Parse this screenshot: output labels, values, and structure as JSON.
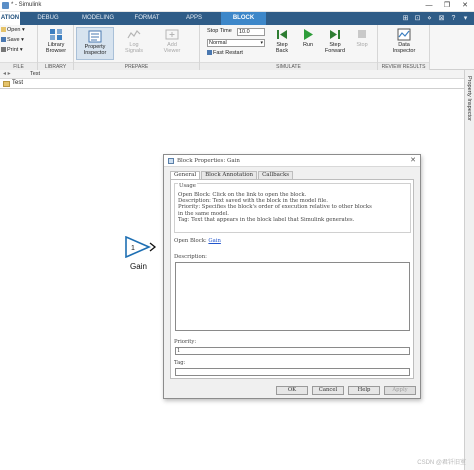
{
  "window": {
    "title": "* - Simulink",
    "controls": [
      "—",
      "❐",
      "✕"
    ]
  },
  "ribbon": {
    "tabs": [
      {
        "label": "ATION",
        "state": "active"
      },
      {
        "label": "DEBUG",
        "state": "normal"
      },
      {
        "label": "MODELING",
        "state": "normal"
      },
      {
        "label": "FORMAT",
        "state": "normal"
      },
      {
        "label": "APPS",
        "state": "normal"
      },
      {
        "label": "BLOCK",
        "state": "block"
      }
    ],
    "right_icons": [
      "⊞",
      "⊡",
      "⋄",
      "⊠",
      "?",
      "▾"
    ]
  },
  "toolstrip": {
    "file": {
      "label": "FILE",
      "items": [
        "Open",
        "Save",
        "Print"
      ]
    },
    "library": {
      "label": "LIBRARY",
      "browser": "Library Browser"
    },
    "prepare": {
      "label": "PREPARE",
      "property_inspector": "Property Inspector",
      "log_signals": "Log Signals",
      "add_viewer": "Add Viewer"
    },
    "simulate": {
      "label": "SIMULATE",
      "stop_time_label": "Stop Time",
      "stop_time_value": "10.0",
      "mode": "Normal",
      "fast_restart": "Fast Restart",
      "step_back": "Step Back",
      "run": "Run",
      "step_forward": "Step Forward",
      "stop": "Stop"
    },
    "review": {
      "label": "REVIEW RESULTS",
      "data_inspector": "Data Inspector"
    }
  },
  "breadcrumb": {
    "tab": "Test",
    "path": "Test"
  },
  "property_inspector_strip": "Property Inspector",
  "canvas": {
    "block": {
      "value": "1",
      "label": "Gain"
    }
  },
  "dialog": {
    "title": "Block Properties: Gain",
    "tabs": [
      "General",
      "Block Annotation",
      "Callbacks"
    ],
    "active_tab": "General",
    "usage": {
      "legend": "Usage",
      "lines": [
        "Open Block: Click on the link to open the block.",
        "Description: Text saved with the block in the model file.",
        "Priority: Specifies the block's order of execution relative to other blocks",
        "in the same model.",
        "Tag: Text that appears in the block label that Simulink generates."
      ]
    },
    "open_block_label": "Open Block:",
    "open_block_link": "Gain",
    "description_label": "Description:",
    "description_value": "",
    "priority_label": "Priority:",
    "priority_value": "1",
    "tag_label": "Tag:",
    "tag_value": "",
    "buttons": {
      "ok": "OK",
      "cancel": "Cancel",
      "help": "Help",
      "apply": "Apply"
    }
  },
  "watermark": "CSDN @君钎旧室",
  "colors": {
    "tab_bar": "#2f5c87",
    "block_tab": "#3d87c9",
    "gain_block": "#1e6fb3",
    "link": "#2255cc"
  }
}
